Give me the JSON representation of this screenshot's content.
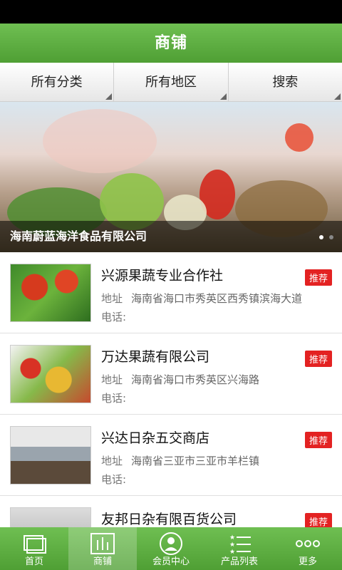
{
  "header": {
    "title": "商铺"
  },
  "filters": [
    {
      "label": "所有分类"
    },
    {
      "label": "所有地区"
    },
    {
      "label": "搜索"
    }
  ],
  "banner": {
    "caption": "海南蔚蓝海洋食品有限公司",
    "slides": 2,
    "active_slide": 1
  },
  "shops": [
    {
      "name": "兴源果蔬专业合作社",
      "tag": "推荐",
      "address_label": "地址",
      "address": "海南省海口市秀英区西秀镇滨海大道",
      "phone_label": "电话:"
    },
    {
      "name": "万达果蔬有限公司",
      "tag": "推荐",
      "address_label": "地址",
      "address": "海南省海口市秀英区兴海路",
      "phone_label": "电话:"
    },
    {
      "name": "兴达日杂五交商店",
      "tag": "推荐",
      "address_label": "地址",
      "address": "海南省三亚市三亚市羊栏镇",
      "phone_label": "电话:"
    },
    {
      "name": "友邦日杂有限百货公司",
      "tag": "推荐",
      "address_label": "",
      "address": "",
      "phone_label": ""
    }
  ],
  "tabs": [
    {
      "label": "首页",
      "icon": "home-icon"
    },
    {
      "label": "商铺",
      "icon": "shop-icon"
    },
    {
      "label": "会员中心",
      "icon": "member-icon"
    },
    {
      "label": "产品列表",
      "icon": "product-list-icon"
    },
    {
      "label": "更多",
      "icon": "more-icon"
    }
  ],
  "colors": {
    "primary": "#5aad3d",
    "tag": "#e32222"
  }
}
